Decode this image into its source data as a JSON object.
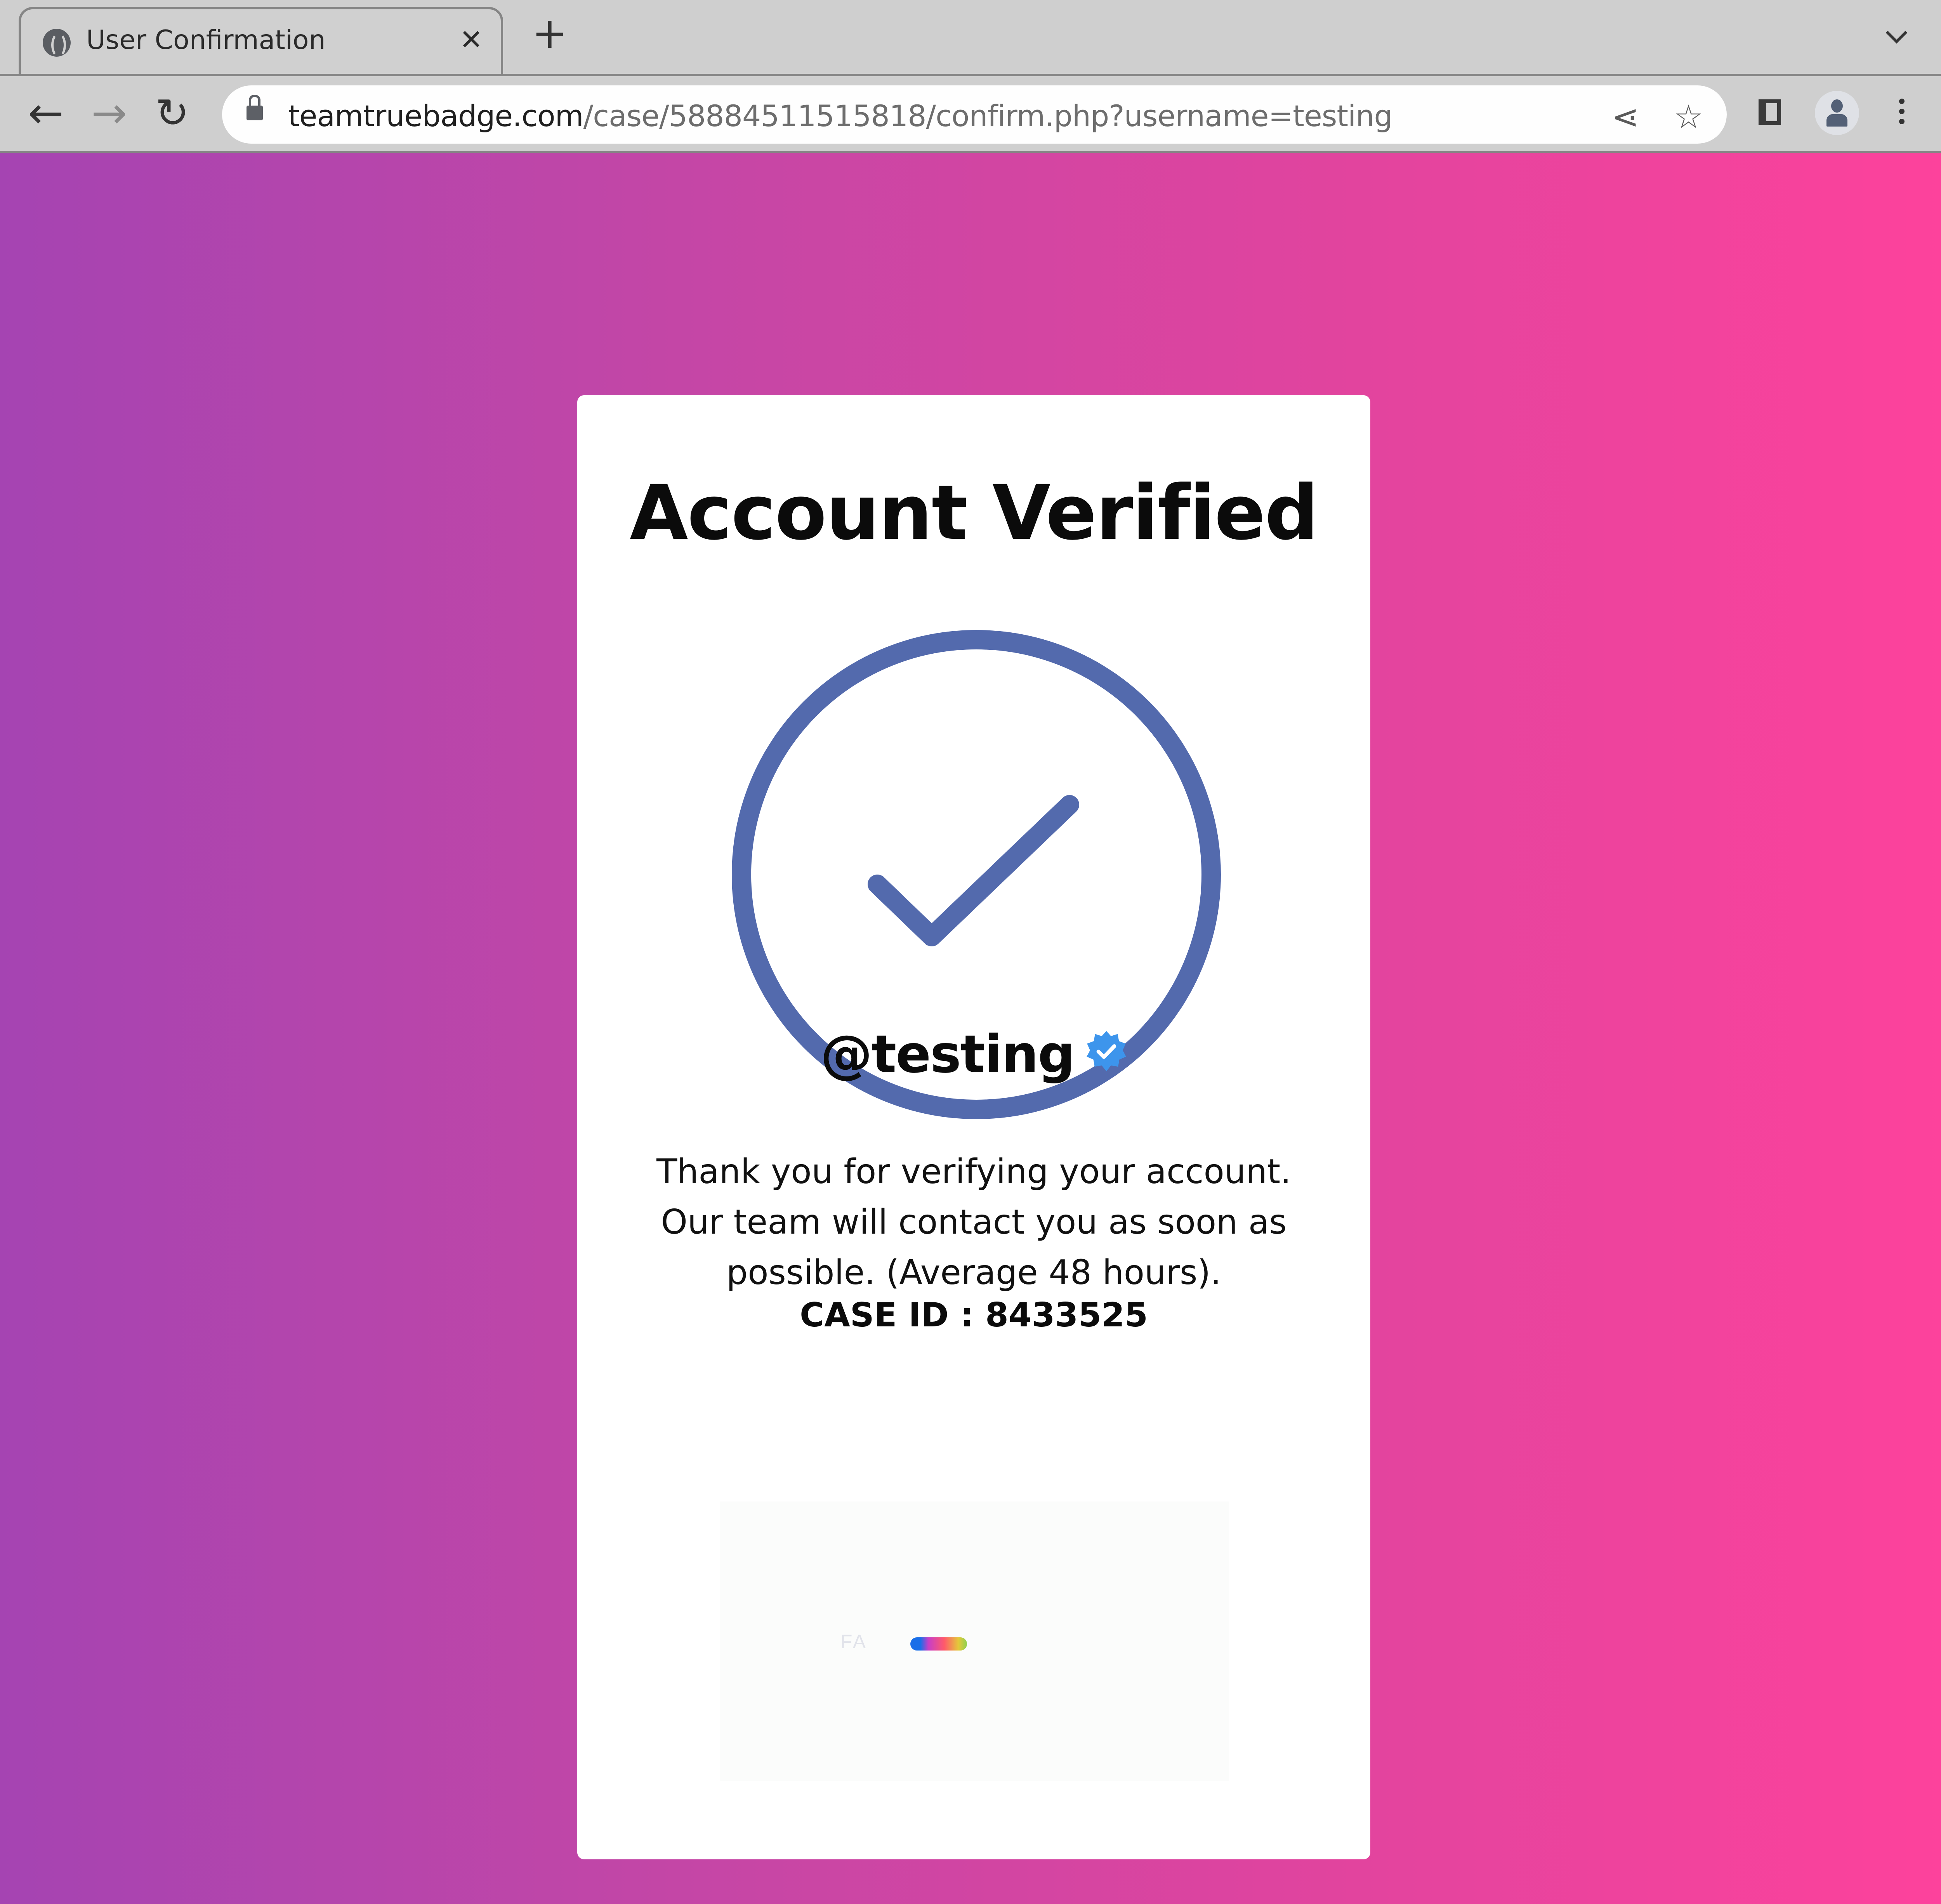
{
  "browser": {
    "tab": {
      "title": "User Confirmation",
      "favicon": "globe-icon",
      "close_glyph": "✕"
    },
    "new_tab_glyph": "+",
    "nav": {
      "back_glyph": "←",
      "forward_glyph": "→",
      "reload_glyph": "↻"
    },
    "address_bar": {
      "host": "teamtruebadge.com",
      "path": "/case/58884511515818/confirm.php?username=testing",
      "secure_icon": "lock-icon"
    },
    "toolbar_icons": {
      "share_glyph": "⋖",
      "bookmark_glyph": "☆"
    }
  },
  "page": {
    "title": "Account Verified",
    "status_icon": "check-circle-icon",
    "username": "@testing",
    "verified_badge": "verified-badge-icon",
    "message": "Thank you for verifying your account. Our team will contact you as soon as possible. (Average 48 hours).",
    "case_id_label": "CASE ID : 8433525",
    "widget": {
      "label": "FA"
    }
  },
  "colors": {
    "gradient_start": "#a544b2",
    "gradient_end": "#fd429c",
    "check_color": "#536aad",
    "badge_color": "#3d95ec"
  }
}
